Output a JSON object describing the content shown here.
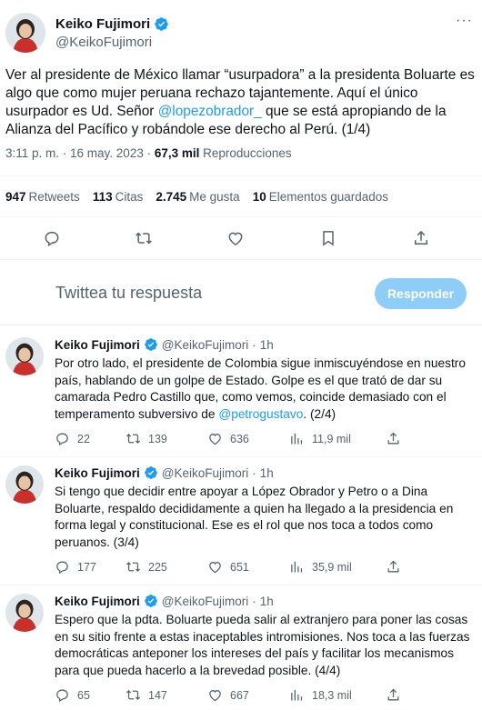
{
  "main": {
    "name": "Keiko Fujimori",
    "handle": "@KeikoFujimori",
    "more": "···",
    "text_pre": "Ver al presidente de México llamar “usurpadora” a la presidenta Boluarte es algo que como mujer peruana rechazo tajantemente. Aquí el único usurpador es Ud. Señor ",
    "mention": "@lopezobrador_",
    "text_post": " que se está apropiando de la Alianza del Pacífico y robándole ese derecho al Perú. (1/4)",
    "time": "3:11 p. m. · 16 may. 2023 · ",
    "views": "67,3 mil",
    "views_label": " Reproducciones",
    "retweets": "947",
    "retweets_label": "Retweets",
    "quotes": "113",
    "quotes_label": "Citas",
    "likes": "2.745",
    "likes_label": "Me gusta",
    "bookmarks": "10",
    "bookmarks_label": "Elementos guardados"
  },
  "reply_box": {
    "placeholder": "Twittea tu respuesta",
    "button": "Responder"
  },
  "replies": [
    {
      "name": "Keiko Fujimori",
      "handle": "@KeikoFujimori",
      "dot": "·",
      "time": "1h",
      "text_pre": "Por otro lado, el presidente de Colombia sigue inmiscuyéndose en nuestro país, hablando de un golpe de Estado. Golpe es el que trató de dar su camarada Pedro Castillo que, como vemos, coincide demasiado con el temperamento subversivo de ",
      "mention": "@petrogustavo",
      "text_post": ". (2/4)",
      "replies": "22",
      "retweets": "139",
      "likes": "636",
      "views": "11,9 mil"
    },
    {
      "name": "Keiko Fujimori",
      "handle": "@KeikoFujimori",
      "dot": "·",
      "time": "1h",
      "text_pre": "Si tengo que decidir entre apoyar a López Obrador y Petro o a Dina Boluarte, respaldo decididamente a quien ha llegado a la presidencia en forma legal y constitucional. Ese es el rol que nos toca a todos como peruanos. (3/4)",
      "mention": "",
      "text_post": "",
      "replies": "177",
      "retweets": "225",
      "likes": "651",
      "views": "35,9 mil"
    },
    {
      "name": "Keiko Fujimori",
      "handle": "@KeikoFujimori",
      "dot": "·",
      "time": "1h",
      "text_pre": "Espero que la pdta. Boluarte pueda salir al extranjero para poner las cosas en su sitio frente a estas inaceptables intromisiones. Nos toca a las fuerzas democráticas anteponer los intereses del país y facilitar los mecanismos para que pueda hacerlo a la brevedad posible. (4/4)",
      "mention": "",
      "text_post": "",
      "replies": "65",
      "retweets": "147",
      "likes": "667",
      "views": "18,3 mil"
    }
  ],
  "colors": {
    "accent": "#1d9bf0",
    "muted": "#536471",
    "reply_button_disabled": "#8ecdf7",
    "divider": "#eff3f4"
  },
  "icons": [
    "verified-badge-icon",
    "reply-icon",
    "retweet-icon",
    "like-icon",
    "bookmark-icon",
    "share-icon",
    "views-icon",
    "more-icon"
  ]
}
